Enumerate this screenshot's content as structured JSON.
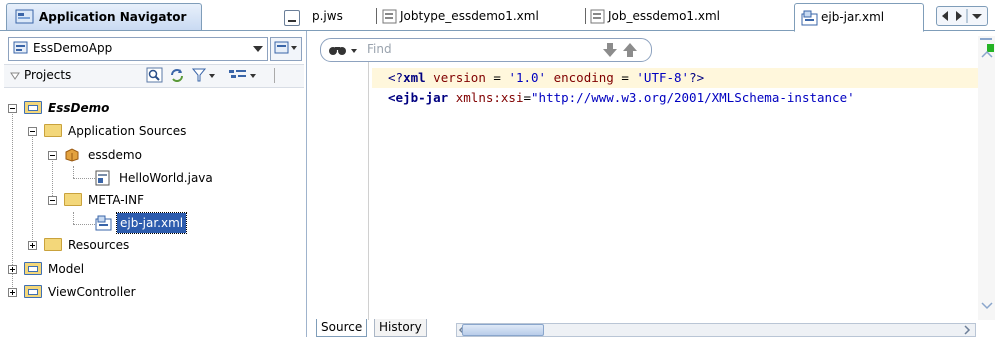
{
  "navigator": {
    "title": "Application Navigator",
    "app_selector": "EssDemoApp",
    "projects_label": "Projects",
    "tree": [
      {
        "label": "EssDemo",
        "bold": true,
        "expander": "minus"
      },
      {
        "label": "Application Sources",
        "expander": "minus"
      },
      {
        "label": "essdemo",
        "expander": "minus"
      },
      {
        "label": "HelloWorld.java"
      },
      {
        "label": "META-INF",
        "expander": "minus"
      },
      {
        "label": "ejb-jar.xml",
        "selected": true
      },
      {
        "label": "Resources",
        "expander": "plus"
      },
      {
        "label": "Model",
        "expander": "plus"
      },
      {
        "label": "ViewController",
        "expander": "plus"
      }
    ]
  },
  "editor": {
    "tabs": [
      {
        "label": "p.jws"
      },
      {
        "label": "Jobtype_essdemo1.xml"
      },
      {
        "label": "Job_essdemo1.xml"
      },
      {
        "label": "ejb-jar.xml",
        "active": true
      }
    ],
    "find_placeholder": "Find",
    "code_lines": [
      {
        "parts": [
          [
            "<?",
            "#000080"
          ],
          [
            "xml",
            "#000080"
          ],
          [
            " version",
            "#800000"
          ],
          [
            " = ",
            "#000"
          ],
          [
            "'1.0'",
            "#0000c0"
          ],
          [
            " encoding",
            "#800000"
          ],
          [
            " = ",
            "#000"
          ],
          [
            "'UTF-8'",
            "#0000c0"
          ],
          [
            "?>",
            "#000080"
          ]
        ]
      },
      {
        "parts": [
          [
            "<",
            "#000080"
          ],
          [
            "ejb-jar",
            "#000080"
          ],
          [
            " xmlns:xsi",
            "#800000"
          ],
          [
            "=",
            "#000"
          ],
          [
            "\"http://www.w3.org/2001/XMLSchema-instance'",
            "#0000c0"
          ]
        ]
      }
    ],
    "bottom_tabs": [
      {
        "label": "Source",
        "active": true
      },
      {
        "label": "History"
      }
    ]
  },
  "colors": {
    "selection": "#2d5cae",
    "accent_border": "#7f9db9",
    "current_line": "#fff7dc"
  }
}
